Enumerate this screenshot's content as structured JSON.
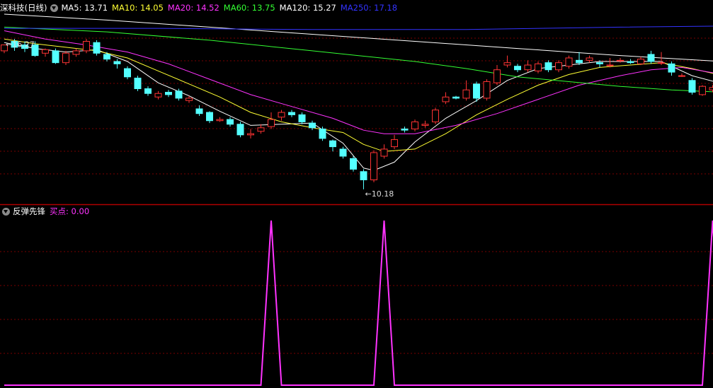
{
  "main_header": {
    "title": "深科技(日线)",
    "ma": [
      {
        "label": "MA5: 13.71",
        "color": "#ffffff"
      },
      {
        "label": "MA10: 14.05",
        "color": "#ffff33"
      },
      {
        "label": "MA20: 14.52",
        "color": "#ff33ff"
      },
      {
        "label": "MA60: 13.75",
        "color": "#33ff33"
      },
      {
        "label": "MA120: 15.27",
        "color": "#ffffff"
      },
      {
        "label": "MA250: 17.18",
        "color": "#3333ff"
      }
    ]
  },
  "sub_header": {
    "title": "反弹先锋",
    "value_label": "买点: 0.00",
    "value_color": "#ff33ff"
  },
  "colors": {
    "up": "#ff3333",
    "down": "#54ffff",
    "grid": "#7a0000",
    "divider": "#b00000"
  },
  "chart_data": [
    {
      "type": "candlestick",
      "ylim": [
        9.6,
        17.6
      ],
      "annotations": [
        {
          "text": "16.27",
          "candle": 0,
          "kind": "high"
        },
        {
          "text": "10.18",
          "candle": 35,
          "kind": "low"
        }
      ],
      "candles": [
        [
          16.05,
          16.3,
          16.3,
          15.95
        ],
        [
          16.45,
          16.2,
          16.55,
          16.05
        ],
        [
          16.3,
          16.15,
          16.45,
          16.0
        ],
        [
          16.3,
          15.85,
          16.45,
          15.8
        ],
        [
          15.95,
          16.1,
          16.15,
          15.8
        ],
        [
          16.05,
          15.55,
          16.15,
          15.5
        ],
        [
          15.55,
          15.95,
          16.05,
          15.45
        ],
        [
          15.9,
          16.05,
          16.15,
          15.8
        ],
        [
          16.05,
          16.45,
          16.55,
          15.95
        ],
        [
          16.4,
          15.95,
          16.5,
          15.85
        ],
        [
          15.9,
          15.7,
          16.0,
          15.6
        ],
        [
          15.6,
          15.5,
          15.7,
          15.3
        ],
        [
          15.3,
          14.95,
          15.4,
          14.85
        ],
        [
          14.9,
          14.45,
          15.0,
          14.35
        ],
        [
          14.45,
          14.25,
          14.55,
          14.15
        ],
        [
          14.1,
          14.25,
          14.35,
          14.0
        ],
        [
          14.3,
          14.2,
          14.4,
          14.1
        ],
        [
          14.35,
          14.05,
          14.45,
          13.95
        ],
        [
          13.95,
          14.05,
          14.15,
          13.85
        ],
        [
          13.6,
          13.4,
          13.75,
          13.3
        ],
        [
          13.45,
          13.1,
          13.5,
          13.0
        ],
        [
          13.1,
          13.15,
          13.25,
          13.05
        ],
        [
          13.15,
          12.95,
          13.25,
          12.85
        ],
        [
          12.95,
          12.5,
          13.05,
          12.4
        ],
        [
          12.5,
          12.55,
          12.75,
          12.35
        ],
        [
          12.65,
          12.8,
          12.95,
          12.55
        ],
        [
          12.85,
          13.15,
          13.45,
          12.75
        ],
        [
          13.25,
          13.45,
          13.55,
          13.1
        ],
        [
          13.45,
          13.35,
          13.55,
          13.25
        ],
        [
          13.35,
          13.05,
          13.45,
          12.95
        ],
        [
          13.0,
          12.8,
          13.1,
          12.7
        ],
        [
          12.75,
          12.35,
          12.85,
          12.25
        ],
        [
          12.25,
          12.0,
          12.3,
          11.8
        ],
        [
          11.9,
          11.6,
          12.0,
          11.5
        ],
        [
          11.5,
          11.05,
          11.6,
          10.95
        ],
        [
          10.95,
          10.6,
          11.05,
          10.2
        ],
        [
          10.6,
          11.75,
          11.85,
          10.5
        ],
        [
          11.6,
          11.9,
          12.1,
          11.5
        ],
        [
          12.0,
          12.3,
          12.5,
          11.9
        ],
        [
          12.75,
          12.7,
          12.85,
          12.6
        ],
        [
          12.75,
          13.05,
          13.15,
          12.65
        ],
        [
          12.9,
          12.95,
          13.1,
          12.8
        ],
        [
          13.05,
          13.55,
          13.65,
          12.95
        ],
        [
          13.9,
          14.1,
          14.3,
          13.8
        ],
        [
          14.1,
          14.05,
          14.15,
          14.0
        ],
        [
          14.05,
          14.4,
          14.8,
          13.95
        ],
        [
          14.65,
          14.05,
          14.75,
          13.9
        ],
        [
          14.05,
          14.75,
          14.85,
          13.95
        ],
        [
          14.7,
          15.25,
          15.45,
          14.6
        ],
        [
          15.45,
          15.55,
          15.85,
          15.35
        ],
        [
          15.4,
          15.25,
          15.5,
          15.15
        ],
        [
          15.25,
          15.45,
          15.65,
          15.15
        ],
        [
          15.2,
          15.5,
          15.6,
          15.1
        ],
        [
          15.55,
          15.25,
          15.65,
          15.15
        ],
        [
          15.25,
          15.55,
          15.65,
          15.15
        ],
        [
          15.4,
          15.75,
          15.85,
          15.3
        ],
        [
          15.65,
          15.55,
          16.0,
          15.45
        ],
        [
          15.65,
          15.75,
          15.85,
          15.55
        ],
        [
          15.55,
          15.5,
          15.65,
          15.35
        ],
        [
          15.45,
          15.45,
          15.75,
          15.35
        ],
        [
          15.65,
          15.65,
          15.75,
          15.55
        ],
        [
          15.6,
          15.55,
          15.7,
          15.5
        ],
        [
          15.5,
          15.7,
          15.8,
          15.45
        ],
        [
          15.9,
          15.6,
          16.05,
          15.5
        ],
        [
          15.55,
          15.55,
          16.0,
          15.45
        ],
        [
          15.5,
          15.15,
          15.6,
          15.0
        ],
        [
          15.0,
          15.0,
          15.1,
          14.95
        ],
        [
          14.8,
          14.3,
          14.9,
          14.2
        ],
        [
          14.2,
          14.55,
          14.6,
          14.15
        ],
        [
          14.4,
          14.5,
          14.6,
          14.3
        ],
        [
          14.6,
          14.75,
          14.85,
          14.5
        ]
      ],
      "ma_series": [
        {
          "name": "MA5",
          "color": "#ffffff",
          "points": [
            [
              0,
              16.4
            ],
            [
              3,
              16.15
            ],
            [
              6,
              16.0
            ],
            [
              9,
              16.1
            ],
            [
              12,
              15.6
            ],
            [
              15,
              14.7
            ],
            [
              18,
              14.15
            ],
            [
              21,
              13.5
            ],
            [
              24,
              12.9
            ],
            [
              27,
              12.95
            ],
            [
              30,
              13.0
            ],
            [
              33,
              12.15
            ],
            [
              35,
              11.1
            ],
            [
              36,
              11.0
            ],
            [
              38,
              11.35
            ],
            [
              40,
              12.2
            ],
            [
              43,
              13.2
            ],
            [
              46,
              13.95
            ],
            [
              49,
              14.8
            ],
            [
              52,
              15.3
            ],
            [
              55,
              15.45
            ],
            [
              58,
              15.6
            ],
            [
              61,
              15.6
            ],
            [
              64,
              15.6
            ],
            [
              67,
              15.0
            ],
            [
              70,
              14.65
            ]
          ]
        },
        {
          "name": "MA10",
          "color": "#ffff33",
          "points": [
            [
              0,
              16.55
            ],
            [
              3,
              16.35
            ],
            [
              6,
              16.2
            ],
            [
              9,
              16.05
            ],
            [
              12,
              15.75
            ],
            [
              15,
              15.2
            ],
            [
              18,
              14.65
            ],
            [
              21,
              14.1
            ],
            [
              24,
              13.45
            ],
            [
              27,
              13.05
            ],
            [
              30,
              12.8
            ],
            [
              33,
              12.6
            ],
            [
              35,
              12.1
            ],
            [
              37,
              11.8
            ],
            [
              40,
              11.9
            ],
            [
              43,
              12.55
            ],
            [
              46,
              13.35
            ],
            [
              49,
              14.0
            ],
            [
              52,
              14.6
            ],
            [
              55,
              15.05
            ],
            [
              58,
              15.35
            ],
            [
              61,
              15.45
            ],
            [
              64,
              15.55
            ],
            [
              67,
              15.3
            ],
            [
              70,
              15.0
            ]
          ]
        },
        {
          "name": "MA20",
          "color": "#ff33ff",
          "points": [
            [
              0,
              16.9
            ],
            [
              4,
              16.55
            ],
            [
              8,
              16.3
            ],
            [
              12,
              16.0
            ],
            [
              16,
              15.5
            ],
            [
              20,
              14.85
            ],
            [
              24,
              14.2
            ],
            [
              28,
              13.7
            ],
            [
              32,
              13.2
            ],
            [
              35,
              12.7
            ],
            [
              37,
              12.55
            ],
            [
              40,
              12.55
            ],
            [
              44,
              12.9
            ],
            [
              48,
              13.4
            ],
            [
              52,
              14.0
            ],
            [
              56,
              14.6
            ],
            [
              60,
              15.0
            ],
            [
              63,
              15.25
            ],
            [
              66,
              15.35
            ],
            [
              68,
              15.2
            ],
            [
              70,
              15.05
            ]
          ]
        },
        {
          "name": "MA60",
          "color": "#33ff33",
          "points": [
            [
              0,
              17.05
            ],
            [
              10,
              16.85
            ],
            [
              20,
              16.5
            ],
            [
              30,
              16.05
            ],
            [
              40,
              15.6
            ],
            [
              45,
              15.3
            ],
            [
              50,
              14.95
            ],
            [
              55,
              14.75
            ],
            [
              60,
              14.55
            ],
            [
              65,
              14.4
            ],
            [
              70,
              14.3
            ]
          ]
        },
        {
          "name": "MA120",
          "color": "#ffffff",
          "points": [
            [
              0,
              17.6
            ],
            [
              10,
              17.35
            ],
            [
              20,
              17.05
            ],
            [
              30,
              16.75
            ],
            [
              40,
              16.45
            ],
            [
              50,
              16.15
            ],
            [
              60,
              15.85
            ],
            [
              70,
              15.6
            ]
          ]
        },
        {
          "name": "MA250",
          "color": "#3333ff",
          "points": [
            [
              0,
              17.0
            ],
            [
              15,
              17.0
            ],
            [
              30,
              16.95
            ],
            [
              45,
              16.95
            ],
            [
              60,
              17.05
            ],
            [
              70,
              17.1
            ]
          ]
        }
      ]
    },
    {
      "type": "line",
      "series": [
        {
          "name": "买点",
          "color": "#ff33ff",
          "points": [
            [
              0,
              0
            ],
            [
              25,
              0
            ],
            [
              26,
              1
            ],
            [
              27,
              0
            ],
            [
              36,
              0
            ],
            [
              37,
              1
            ],
            [
              38,
              0
            ],
            [
              68,
              0
            ],
            [
              69,
              1
            ],
            [
              70,
              0
            ],
            [
              71,
              0
            ]
          ]
        }
      ],
      "ylim": [
        0,
        1
      ]
    }
  ]
}
